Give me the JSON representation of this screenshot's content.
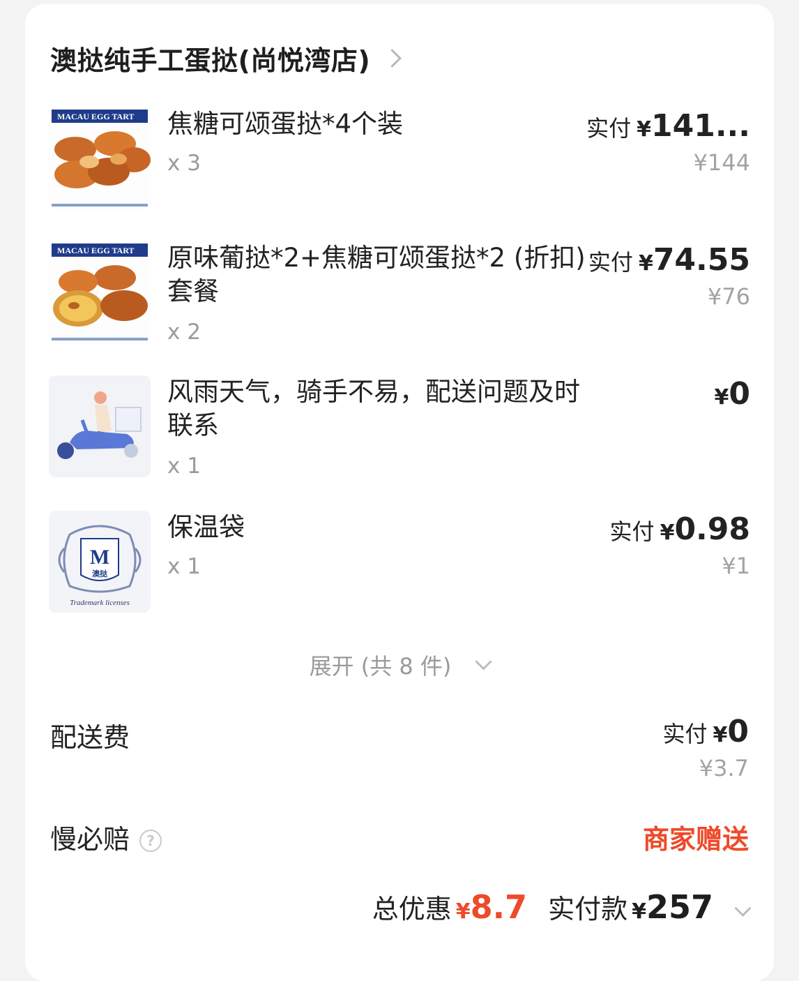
{
  "shop": {
    "name": "澳挞纯手工蛋挞(尚悦湾店)"
  },
  "items": [
    {
      "name": "焦糖可颂蛋挞*4个装",
      "qty": "x 3",
      "paid_label": "实付",
      "currency": "¥",
      "paid": "141...",
      "original": "¥144",
      "thumb_text": "MACAU EGG TART"
    },
    {
      "name": "原味葡挞*2+焦糖可颂蛋挞*2 (折扣) 套餐",
      "qty": "x 2",
      "paid_label": "实付",
      "currency": "¥",
      "paid": "74.55",
      "original": "¥76",
      "thumb_text": "MACAU EGG TART"
    },
    {
      "name": "风雨天气，骑手不易，配送问题及时联系",
      "qty": "x 1",
      "paid_label": "",
      "currency": "¥",
      "paid": "0",
      "original": ""
    },
    {
      "name": "保温袋",
      "qty": "x 1",
      "paid_label": "实付",
      "currency": "¥",
      "paid": "0.98",
      "original": "¥1",
      "thumb_text": "M",
      "thumb_sub": "澳挞",
      "thumb_caption": "Trademark licenses"
    }
  ],
  "expand": {
    "label": "展开 (共 8 件)"
  },
  "delivery": {
    "label": "配送费",
    "paid_label": "实付",
    "currency": "¥",
    "paid": "0",
    "original": "¥3.7"
  },
  "late_compensation": {
    "label": "慢必赔",
    "help": "?",
    "value": "商家赠送"
  },
  "summary": {
    "discount_label": "总优惠",
    "discount_currency": "¥",
    "discount": "8.7",
    "total_label": "实付款",
    "total_currency": "¥",
    "total": "257"
  },
  "colors": {
    "accent": "#ee4a2a",
    "thumb_blue": "#1f3b8a"
  }
}
